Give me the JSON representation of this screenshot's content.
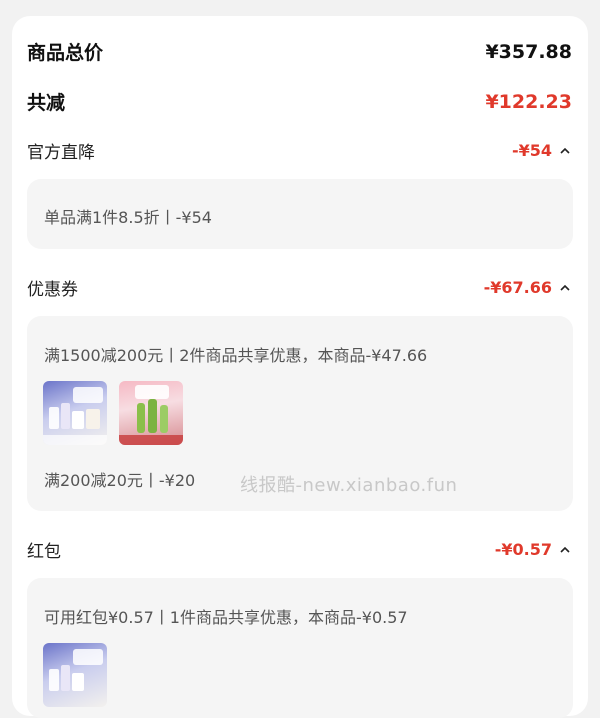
{
  "summary": {
    "total_label": "商品总价",
    "total_value": "¥357.88",
    "reduce_label": "共减",
    "reduce_value": "¥122.23"
  },
  "sections": [
    {
      "label": "官方直降",
      "amount": "-¥54",
      "lines": [
        "单品满1件8.5折丨-¥54"
      ]
    },
    {
      "label": "优惠券",
      "amount": "-¥67.66",
      "lines": [
        "满1500减200元丨2件商品共享优惠，本商品-¥47.66",
        "满200减20元丨-¥20"
      ]
    },
    {
      "label": "红包",
      "amount": "-¥0.57",
      "lines": [
        "可用红包¥0.57丨1件商品共享优惠，本商品-¥0.57"
      ]
    }
  ],
  "watermark": "线报酷-new.xianbao.fun",
  "colors": {
    "accent": "#e0392b",
    "card_bg": "#ffffff",
    "box_bg": "#f5f5f5"
  }
}
